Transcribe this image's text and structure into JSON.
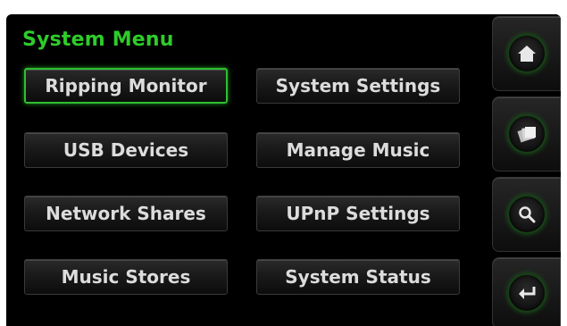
{
  "title": "System Menu",
  "menu": {
    "left": [
      {
        "label": "Ripping Monitor",
        "selected": true
      },
      {
        "label": "USB Devices",
        "selected": false
      },
      {
        "label": "Network Shares",
        "selected": false
      },
      {
        "label": "Music Stores",
        "selected": false
      }
    ],
    "right": [
      {
        "label": "System Settings",
        "selected": false
      },
      {
        "label": "Manage Music",
        "selected": false
      },
      {
        "label": "UPnP Settings",
        "selected": false
      },
      {
        "label": "System Status",
        "selected": false
      }
    ]
  },
  "side_buttons": [
    {
      "icon": "home-icon"
    },
    {
      "icon": "album-stack-icon"
    },
    {
      "icon": "search-icon"
    },
    {
      "icon": "enter-icon"
    }
  ],
  "colors": {
    "accent_green": "#2ecc2a",
    "selected_border": "#2fbf2f",
    "background": "#000000",
    "button_text": "#dcdcdc"
  }
}
